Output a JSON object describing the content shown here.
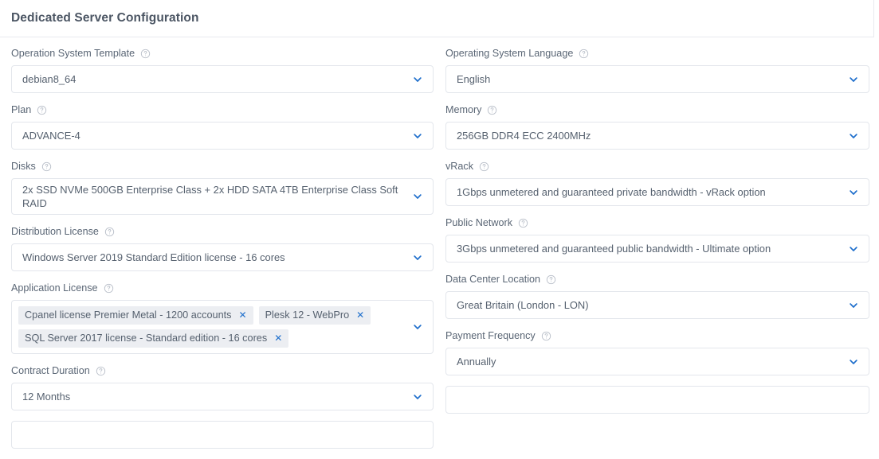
{
  "header": {
    "title": "Dedicated Server Configuration"
  },
  "icons": {
    "help": "help-circle-icon",
    "chevron": "chevron-down-icon",
    "remove": "close-icon"
  },
  "colors": {
    "accent": "#1f6fcc",
    "label_text": "#5a6675",
    "value_text": "#56616f",
    "border": "#e3e6ec",
    "chip_background": "#eceef2",
    "title_text": "#4b5563",
    "page_background": "#ffffff"
  },
  "left_column": [
    {
      "label": "Operation System Template",
      "value": "debian8_64",
      "type": "select"
    },
    {
      "label": "Plan",
      "value": "ADVANCE-4",
      "type": "select"
    },
    {
      "label": "Disks",
      "value": "2x SSD NVMe 500GB Enterprise Class + 2x HDD SATA 4TB Enterprise Class Soft RAID",
      "type": "select-multiline"
    },
    {
      "label": "Distribution License",
      "value": "Windows Server 2019 Standard Edition license - 16 cores",
      "type": "select"
    },
    {
      "label": "Application License",
      "type": "multiselect",
      "chips": [
        "Cpanel license Premier Metal - 1200 accounts",
        "Plesk 12 - WebPro",
        "SQL Server 2017 license - Standard edition - 16 cores"
      ]
    },
    {
      "label": "Contract Duration",
      "value": "12 Months",
      "type": "select"
    }
  ],
  "right_column": [
    {
      "label": "Operating System Language",
      "value": "English",
      "type": "select"
    },
    {
      "label": "Memory",
      "value": "256GB DDR4 ECC 2400MHz",
      "type": "select"
    },
    {
      "label": "vRack",
      "value": "1Gbps unmetered and guaranteed private bandwidth - vRack option",
      "type": "select"
    },
    {
      "label": "Public Network",
      "value": "3Gbps unmetered and guaranteed public bandwidth - Ultimate option",
      "type": "select"
    },
    {
      "label": "Data Center Location",
      "value": "Great Britain (London - LON)",
      "type": "select"
    },
    {
      "label": "Payment Frequency",
      "value": "Annually",
      "type": "select"
    }
  ]
}
